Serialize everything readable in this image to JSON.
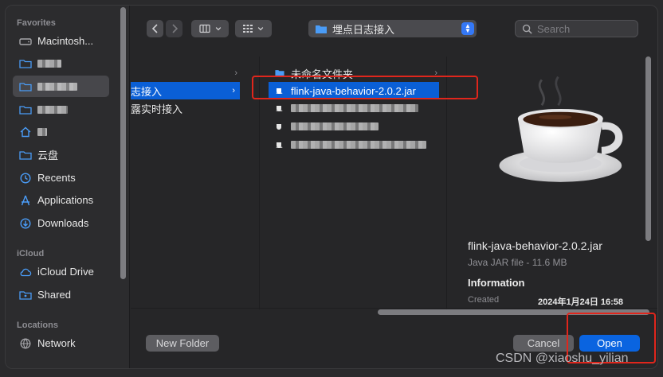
{
  "sidebar": {
    "favorites_label": "Favorites",
    "icloud_label": "iCloud",
    "locations_label": "Locations",
    "items": [
      {
        "label": "Macintosh..."
      },
      {
        "label": ""
      },
      {
        "label": ""
      },
      {
        "label": ""
      },
      {
        "label": ""
      },
      {
        "label": "云盘"
      },
      {
        "label": "Recents"
      },
      {
        "label": "Applications"
      },
      {
        "label": "Downloads"
      },
      {
        "label": "iCloud Drive"
      },
      {
        "label": "Shared"
      },
      {
        "label": "Network"
      }
    ]
  },
  "toolbar": {
    "path": "埋点日志接入",
    "search_placeholder": "Search"
  },
  "column1": {
    "items": [
      {
        "label": ""
      },
      {
        "label": "志接入"
      },
      {
        "label": "露实时接入"
      }
    ]
  },
  "column2": {
    "items": [
      {
        "label": "未命名文件夹"
      },
      {
        "label": "flink-java-behavior-2.0.2.jar"
      }
    ]
  },
  "preview": {
    "name": "flink-java-behavior-2.0.2.jar",
    "kind": "Java JAR file - 11.6 MB",
    "info_title": "Information",
    "created_label": "Created",
    "created_value": "2024年1月24日 16:58"
  },
  "buttons": {
    "new_folder": "New Folder",
    "cancel": "Cancel",
    "open": "Open"
  },
  "watermark": "CSDN @xiaoshu_yilian",
  "colors": {
    "accent": "#0a64e0",
    "highlight_box": "#e0261c"
  }
}
